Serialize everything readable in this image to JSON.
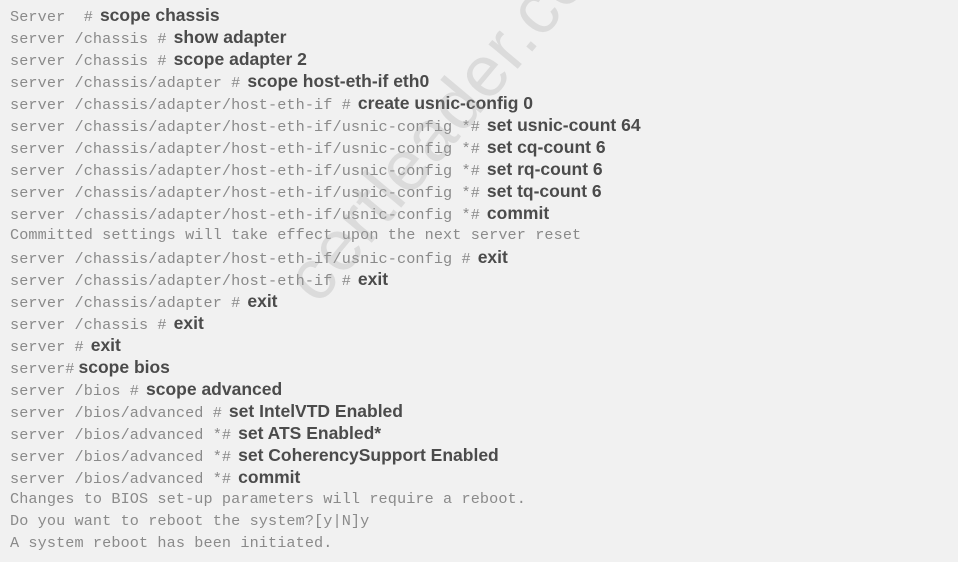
{
  "terminal": {
    "lines": [
      {
        "prompt": "Server  #",
        "command": "scope chassis"
      },
      {
        "prompt": "server /chassis #",
        "command": "show adapter"
      },
      {
        "prompt": "server /chassis #",
        "command": "scope adapter 2"
      },
      {
        "prompt": "server /chassis/adapter #",
        "command": "scope host-eth-if eth0"
      },
      {
        "prompt": "server /chassis/adapter/host-eth-if #",
        "command": "create usnic-config 0"
      },
      {
        "prompt": "server /chassis/adapter/host-eth-if/usnic-config *#",
        "command": "set usnic-count 64"
      },
      {
        "prompt": "server /chassis/adapter/host-eth-if/usnic-config *#",
        "command": "set cq-count 6"
      },
      {
        "prompt": "server /chassis/adapter/host-eth-if/usnic-config *#",
        "command": "set rq-count 6"
      },
      {
        "prompt": "server /chassis/adapter/host-eth-if/usnic-config *#",
        "command": "set tq-count 6"
      },
      {
        "prompt": "server /chassis/adapter/host-eth-if/usnic-config *#",
        "command": "commit"
      },
      {
        "output": "Committed settings will take effect upon the next server reset"
      },
      {
        "prompt": "server /chassis/adapter/host-eth-if/usnic-config #",
        "command": "exit"
      },
      {
        "prompt": "server /chassis/adapter/host-eth-if #",
        "command": "exit"
      },
      {
        "prompt": "server /chassis/adapter #",
        "command": "exit"
      },
      {
        "prompt": "server /chassis #",
        "command": "exit"
      },
      {
        "prompt": "server #",
        "command": "exit"
      },
      {
        "prompt": "server#",
        "command": "scope bios"
      },
      {
        "prompt": "server /bios #",
        "command": "scope advanced"
      },
      {
        "prompt": "server /bios/advanced #",
        "command": "set IntelVTD Enabled"
      },
      {
        "prompt": "server /bios/advanced *#",
        "command": "set ATS Enabled*"
      },
      {
        "prompt": "server /bios/advanced *#",
        "command": "set CoherencySupport Enabled"
      },
      {
        "prompt": "server /bios/advanced *#",
        "command": "commit"
      },
      {
        "output": "Changes to BIOS set-up parameters will require a reboot."
      },
      {
        "output": "Do you want to reboot the system?[y|N]y"
      },
      {
        "output": "A system reboot has been initiated."
      }
    ]
  },
  "watermark": {
    "text": "certleader.com"
  }
}
